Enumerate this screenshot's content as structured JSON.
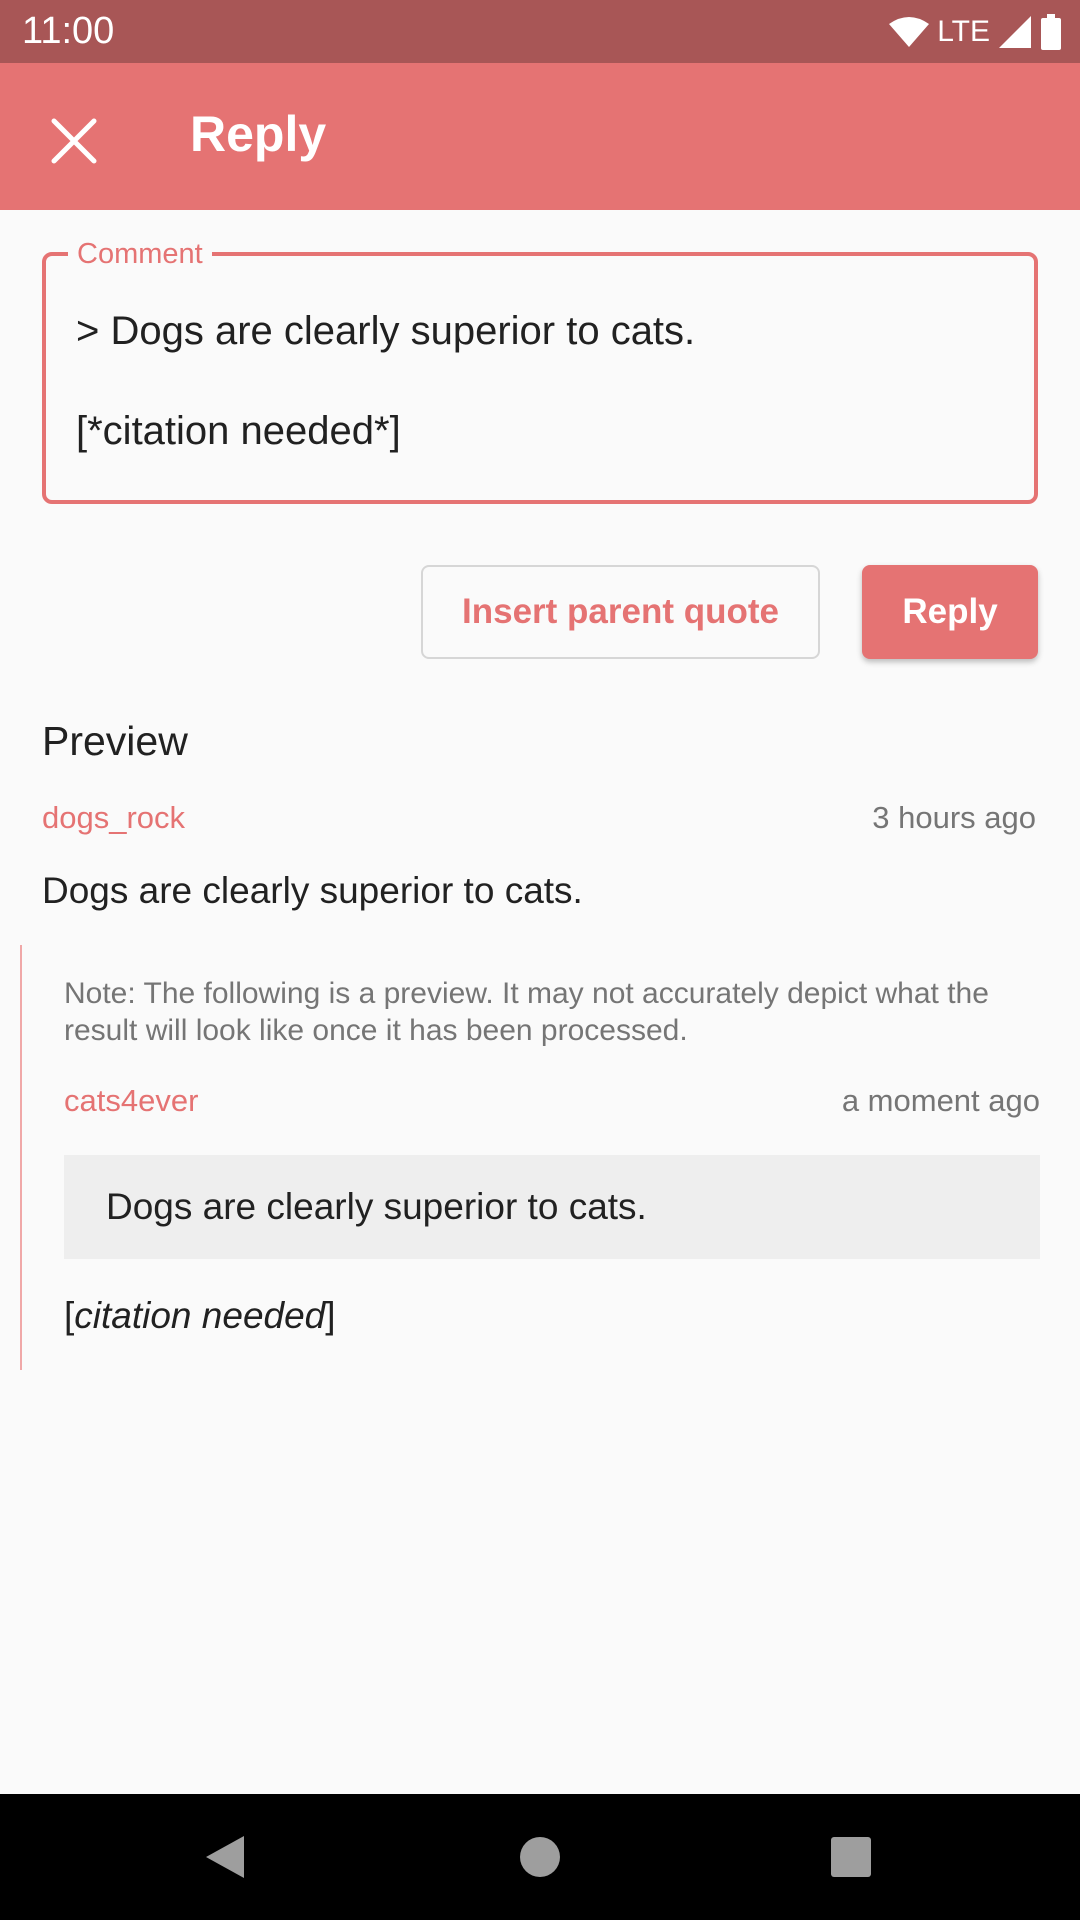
{
  "status_bar": {
    "time": "11:00",
    "network": "LTE"
  },
  "app_bar": {
    "title": "Reply"
  },
  "comment": {
    "label": "Comment",
    "value": "> Dogs are clearly superior to cats.\n\n[*citation needed*]"
  },
  "actions": {
    "insert_quote": "Insert parent quote",
    "reply": "Reply"
  },
  "preview": {
    "heading": "Preview",
    "parent": {
      "author": "dogs_rock",
      "time": "3 hours ago",
      "body": "Dogs are clearly superior to cats."
    },
    "note": "Note: The following is a preview. It may not accurately depict what the result will look like once it has been processed.",
    "child": {
      "author": "cats4ever",
      "time": "a moment ago",
      "quote": "Dogs are clearly superior to cats.",
      "citation_open": "[",
      "citation_text": "citation needed",
      "citation_close": "]"
    }
  },
  "colors": {
    "primary": "#e57373",
    "status_bar": "#a85656",
    "background": "#fafafa"
  }
}
